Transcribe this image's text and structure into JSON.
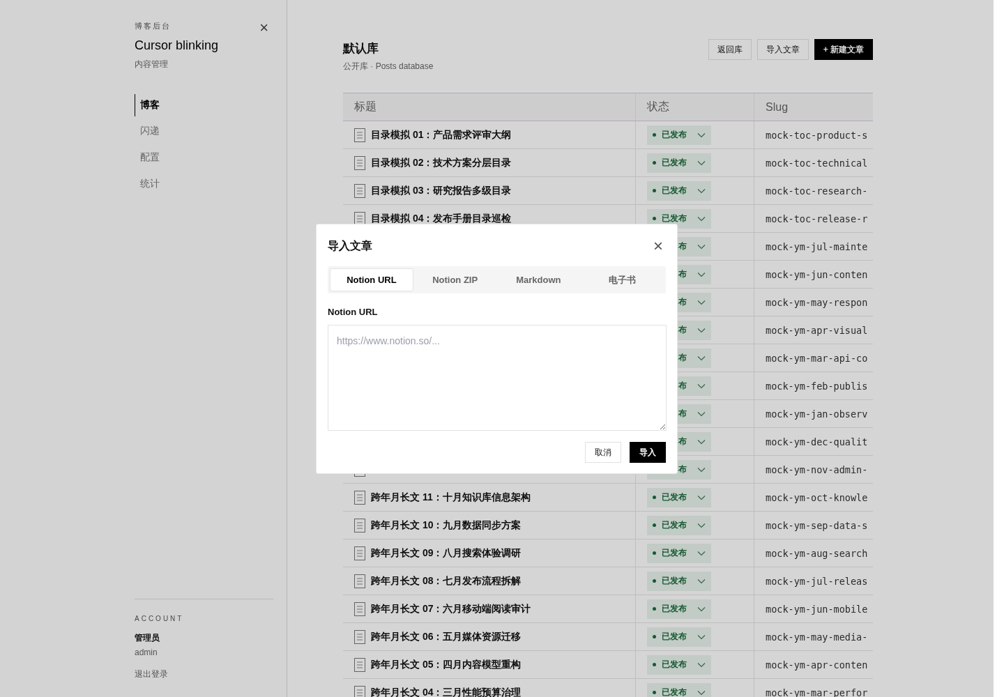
{
  "sidebar": {
    "eyebrow": "博客后台",
    "title": "Cursor blinking",
    "subtitle": "内容管理",
    "close": "×",
    "items": [
      {
        "label": "博客",
        "selected": true
      },
      {
        "label": "闪递",
        "selected": false
      },
      {
        "label": "配置",
        "selected": false
      },
      {
        "label": "统计",
        "selected": false
      }
    ],
    "account": {
      "heading": "ACCOUNT",
      "name": "管理员",
      "username": "admin",
      "logout": "退出登录"
    }
  },
  "header": {
    "title": "默认库",
    "subtitle": "公开库 · Posts database",
    "buttons": [
      {
        "label": "返回库",
        "kind": "secondary"
      },
      {
        "label": "导入文章",
        "kind": "secondary"
      },
      {
        "label": "+ 新建文章",
        "kind": "primary"
      }
    ]
  },
  "table": {
    "columns": [
      "标题",
      "状态",
      "Slug"
    ],
    "rows": [
      {
        "icon": true,
        "title": "目录模拟 01：产品需求评审大纲",
        "status": "已发布",
        "slug": "mock-toc-product-s"
      },
      {
        "icon": true,
        "title": "目录模拟 02：技术方案分层目录",
        "status": "已发布",
        "slug": "mock-toc-technical"
      },
      {
        "icon": true,
        "title": "目录模拟 03：研究报告多级目录",
        "status": "已发布",
        "slug": "mock-toc-research-"
      },
      {
        "icon": true,
        "title": "目录模拟 04：发布手册目录巡检",
        "status": "已发布",
        "slug": "mock-toc-release-r"
      },
      {
        "status": "布",
        "slug": "mock-ym-jul-mainte"
      },
      {
        "status": "布",
        "slug": "mock-ym-jun-conten"
      },
      {
        "status": "布",
        "slug": "mock-ym-may-respon"
      },
      {
        "status": "布",
        "slug": "mock-ym-apr-visual"
      },
      {
        "status": "布",
        "slug": "mock-ym-mar-api-co"
      },
      {
        "status": "布",
        "slug": "mock-ym-feb-publis"
      },
      {
        "status": "布",
        "slug": "mock-ym-jan-observ"
      },
      {
        "status": "布",
        "slug": "mock-ym-dec-qualit"
      },
      {
        "icon": true,
        "status": "布",
        "slug": "mock-ym-nov-admin-"
      },
      {
        "icon": true,
        "title": "跨年月长文 11：十月知识库信息架构",
        "status": "已发布",
        "slug": "mock-ym-oct-knowle"
      },
      {
        "icon": true,
        "title": "跨年月长文 10：九月数据同步方案",
        "status": "已发布",
        "slug": "mock-ym-sep-data-s"
      },
      {
        "icon": true,
        "title": "跨年月长文 09：八月搜索体验调研",
        "status": "已发布",
        "slug": "mock-ym-aug-search"
      },
      {
        "icon": true,
        "title": "跨年月长文 08：七月发布流程拆解",
        "status": "已发布",
        "slug": "mock-ym-jul-releas"
      },
      {
        "icon": true,
        "title": "跨年月长文 07：六月移动端阅读审计",
        "status": "已发布",
        "slug": "mock-ym-jun-mobile"
      },
      {
        "icon": true,
        "title": "跨年月长文 06：五月媒体资源迁移",
        "status": "已发布",
        "slug": "mock-ym-may-media-"
      },
      {
        "icon": true,
        "title": "跨年月长文 05：四月内容模型重构",
        "status": "已发布",
        "slug": "mock-ym-apr-conten"
      },
      {
        "icon": true,
        "title": "跨年月长文 04：三月性能预算治理",
        "status": "已发布",
        "slug": "mock-ym-mar-perfor"
      }
    ]
  },
  "dialog": {
    "title": "导入文章",
    "close": "×",
    "tabs": [
      {
        "label": "Notion URL",
        "selected": true
      },
      {
        "label": "Notion ZIP",
        "selected": false
      },
      {
        "label": "Markdown",
        "selected": false
      },
      {
        "label": "电子书",
        "selected": false
      }
    ],
    "field_label": "Notion URL",
    "placeholder": "https://www.notion.so/...",
    "buttons": [
      {
        "label": "取消",
        "kind": "secondary"
      },
      {
        "label": "导入",
        "kind": "primary"
      }
    ]
  }
}
